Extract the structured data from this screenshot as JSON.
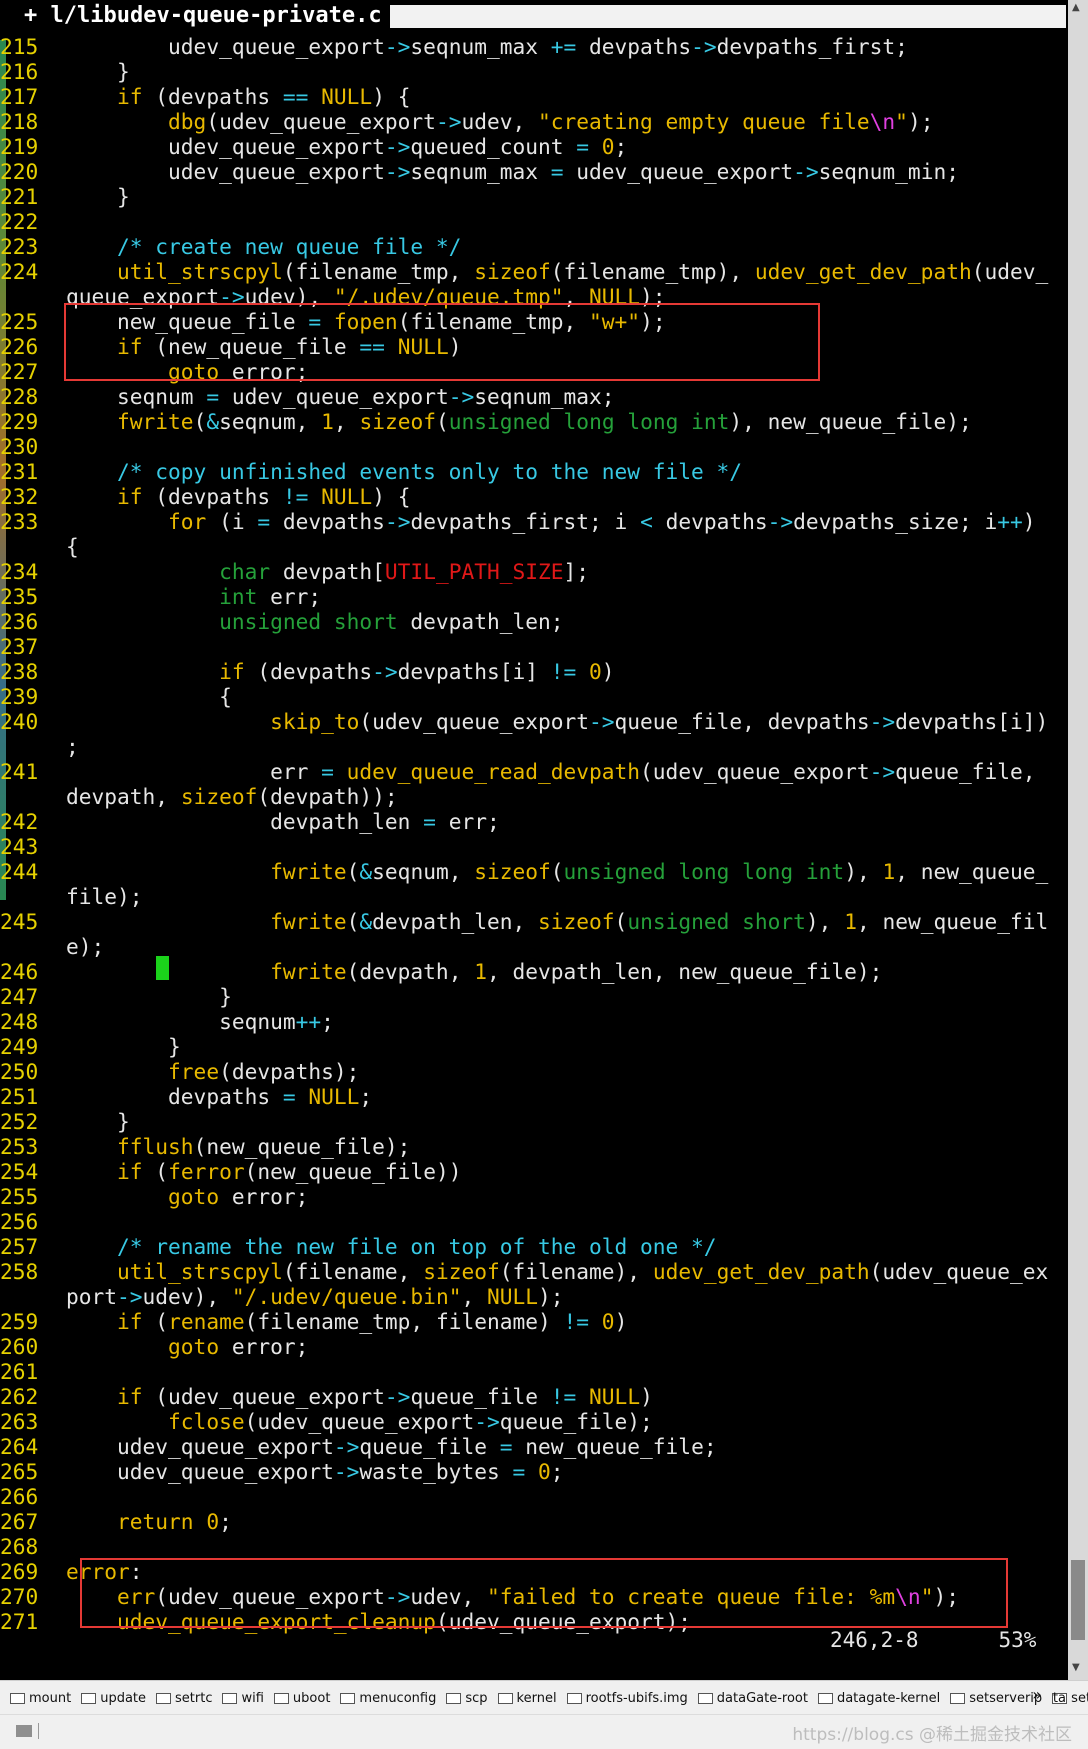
{
  "tab": {
    "label": "+ l/libudev-queue-private.c"
  },
  "ruler": {
    "position": "246,2-8",
    "percent": "53%"
  },
  "bookmarks": [
    "mount",
    "update",
    "setrtc",
    "wifi",
    "uboot",
    "menuconfig",
    "scp",
    "kernel",
    "rootfs-ubifs.img",
    "dataGate-root",
    "datagate-kernel",
    "setserverip",
    "setl"
  ],
  "bookmarks_more": "»",
  "bookmark_trailing": "ta",
  "watermark": "https://blog.cs @稀土掘金技术社区",
  "code_lines": [
    {
      "n": "215",
      "t": [
        [
          "pl",
          "        udev_queue_export"
        ],
        [
          "op",
          "->"
        ],
        [
          "pl",
          "seqnum_max "
        ],
        [
          "op",
          "+="
        ],
        [
          "pl",
          " devpaths"
        ],
        [
          "op",
          "->"
        ],
        [
          "pl",
          "devpaths_first;"
        ]
      ]
    },
    {
      "n": "216",
      "t": [
        [
          "pl",
          "    }"
        ]
      ]
    },
    {
      "n": "217",
      "t": [
        [
          "kw",
          "    if"
        ],
        [
          "pl",
          " (devpaths "
        ],
        [
          "op",
          "=="
        ],
        [
          "pl",
          " "
        ],
        [
          "kw",
          "NULL"
        ],
        [
          "pl",
          ") {"
        ]
      ]
    },
    {
      "n": "218",
      "t": [
        [
          "fn",
          "        dbg"
        ],
        [
          "pl",
          "(udev_queue_export"
        ],
        [
          "op",
          "->"
        ],
        [
          "pl",
          "udev, "
        ],
        [
          "str",
          "\"creating empty queue file"
        ],
        [
          "esc",
          "\\n"
        ],
        [
          "str",
          "\""
        ],
        [
          "pl",
          ");"
        ]
      ]
    },
    {
      "n": "219",
      "t": [
        [
          "pl",
          "        udev_queue_export"
        ],
        [
          "op",
          "->"
        ],
        [
          "pl",
          "queued_count "
        ],
        [
          "op",
          "="
        ],
        [
          "pl",
          " "
        ],
        [
          "kw",
          "0"
        ],
        [
          "pl",
          ";"
        ]
      ]
    },
    {
      "n": "220",
      "t": [
        [
          "pl",
          "        udev_queue_export"
        ],
        [
          "op",
          "->"
        ],
        [
          "pl",
          "seqnum_max "
        ],
        [
          "op",
          "="
        ],
        [
          "pl",
          " udev_queue_export"
        ],
        [
          "op",
          "->"
        ],
        [
          "pl",
          "seqnum_min;"
        ]
      ]
    },
    {
      "n": "221",
      "t": [
        [
          "pl",
          "    }"
        ]
      ]
    },
    {
      "n": "222",
      "t": [
        [
          "pl",
          ""
        ]
      ]
    },
    {
      "n": "223",
      "t": [
        [
          "cm",
          "    /* create new queue file */"
        ]
      ]
    },
    {
      "n": "224",
      "t": [
        [
          "fn",
          "    util_strscpyl"
        ],
        [
          "pl",
          "(filename_tmp, "
        ],
        [
          "kw",
          "sizeof"
        ],
        [
          "pl",
          "(filename_tmp), "
        ],
        [
          "fn",
          "udev_get_dev_path"
        ],
        [
          "pl",
          "(udev_"
        ]
      ]
    },
    {
      "n": "",
      "t": [
        [
          "pl",
          "queue_export"
        ],
        [
          "op",
          "->"
        ],
        [
          "pl",
          "udev), "
        ],
        [
          "str",
          "\"/.udev/queue.tmp\""
        ],
        [
          "pl",
          ", "
        ],
        [
          "kw",
          "NULL"
        ],
        [
          "pl",
          ");"
        ]
      ]
    },
    {
      "n": "225",
      "t": [
        [
          "pl",
          "    new_queue_file "
        ],
        [
          "op",
          "="
        ],
        [
          "pl",
          " "
        ],
        [
          "fn",
          "fopen"
        ],
        [
          "pl",
          "(filename_tmp, "
        ],
        [
          "str",
          "\"w+\""
        ],
        [
          "pl",
          ");"
        ]
      ]
    },
    {
      "n": "226",
      "t": [
        [
          "kw",
          "    if"
        ],
        [
          "pl",
          " (new_queue_file "
        ],
        [
          "op",
          "=="
        ],
        [
          "pl",
          " "
        ],
        [
          "kw",
          "NULL"
        ],
        [
          "pl",
          ")"
        ]
      ]
    },
    {
      "n": "227",
      "t": [
        [
          "kw",
          "        goto"
        ],
        [
          "pl",
          " error;"
        ]
      ]
    },
    {
      "n": "228",
      "t": [
        [
          "pl",
          "    seqnum "
        ],
        [
          "op",
          "="
        ],
        [
          "pl",
          " udev_queue_export"
        ],
        [
          "op",
          "->"
        ],
        [
          "pl",
          "seqnum_max;"
        ]
      ]
    },
    {
      "n": "229",
      "t": [
        [
          "fn",
          "    fwrite"
        ],
        [
          "pl",
          "("
        ],
        [
          "op",
          "&"
        ],
        [
          "pl",
          "seqnum, "
        ],
        [
          "kw",
          "1"
        ],
        [
          "pl",
          ", "
        ],
        [
          "kw",
          "sizeof"
        ],
        [
          "pl",
          "("
        ],
        [
          "ty",
          "unsigned long long int"
        ],
        [
          "pl",
          "), new_queue_file);"
        ]
      ]
    },
    {
      "n": "230",
      "t": [
        [
          "pl",
          ""
        ]
      ]
    },
    {
      "n": "231",
      "t": [
        [
          "cm",
          "    /* copy unfinished events only to the new file */"
        ]
      ]
    },
    {
      "n": "232",
      "t": [
        [
          "kw",
          "    if"
        ],
        [
          "pl",
          " (devpaths "
        ],
        [
          "op",
          "!="
        ],
        [
          "pl",
          " "
        ],
        [
          "kw",
          "NULL"
        ],
        [
          "pl",
          ") {"
        ]
      ]
    },
    {
      "n": "233",
      "t": [
        [
          "kw",
          "        for"
        ],
        [
          "pl",
          " (i "
        ],
        [
          "op",
          "="
        ],
        [
          "pl",
          " devpaths"
        ],
        [
          "op",
          "->"
        ],
        [
          "pl",
          "devpaths_first; i "
        ],
        [
          "op",
          "<"
        ],
        [
          "pl",
          " devpaths"
        ],
        [
          "op",
          "->"
        ],
        [
          "pl",
          "devpaths_size; i"
        ],
        [
          "op",
          "++"
        ],
        [
          "pl",
          ")"
        ]
      ]
    },
    {
      "n": "",
      "t": [
        [
          "pl",
          "{"
        ]
      ]
    },
    {
      "n": "234",
      "t": [
        [
          "ty",
          "            char"
        ],
        [
          "pl",
          " devpath["
        ],
        [
          "mac",
          "UTIL_PATH_SIZE"
        ],
        [
          "pl",
          "];"
        ]
      ]
    },
    {
      "n": "235",
      "t": [
        [
          "ty",
          "            int"
        ],
        [
          "pl",
          " err;"
        ]
      ]
    },
    {
      "n": "236",
      "t": [
        [
          "ty",
          "            unsigned short"
        ],
        [
          "pl",
          " devpath_len;"
        ]
      ]
    },
    {
      "n": "237",
      "t": [
        [
          "pl",
          ""
        ]
      ]
    },
    {
      "n": "238",
      "t": [
        [
          "kw",
          "            if"
        ],
        [
          "pl",
          " (devpaths"
        ],
        [
          "op",
          "->"
        ],
        [
          "pl",
          "devpaths[i] "
        ],
        [
          "op",
          "!="
        ],
        [
          "pl",
          " "
        ],
        [
          "kw",
          "0"
        ],
        [
          "pl",
          ")"
        ]
      ]
    },
    {
      "n": "239",
      "t": [
        [
          "pl",
          "            {"
        ]
      ]
    },
    {
      "n": "240",
      "t": [
        [
          "fn",
          "                skip_to"
        ],
        [
          "pl",
          "(udev_queue_export"
        ],
        [
          "op",
          "->"
        ],
        [
          "pl",
          "queue_file, devpaths"
        ],
        [
          "op",
          "->"
        ],
        [
          "pl",
          "devpaths[i])"
        ]
      ]
    },
    {
      "n": "",
      "t": [
        [
          "pl",
          ";"
        ]
      ]
    },
    {
      "n": "241",
      "t": [
        [
          "pl",
          "                err "
        ],
        [
          "op",
          "="
        ],
        [
          "pl",
          " "
        ],
        [
          "fn",
          "udev_queue_read_devpath"
        ],
        [
          "pl",
          "(udev_queue_export"
        ],
        [
          "op",
          "->"
        ],
        [
          "pl",
          "queue_file,"
        ]
      ]
    },
    {
      "n": "",
      "t": [
        [
          "pl",
          "devpath, "
        ],
        [
          "kw",
          "sizeof"
        ],
        [
          "pl",
          "(devpath));"
        ]
      ]
    },
    {
      "n": "242",
      "t": [
        [
          "pl",
          "                devpath_len "
        ],
        [
          "op",
          "="
        ],
        [
          "pl",
          " err;"
        ]
      ]
    },
    {
      "n": "243",
      "t": [
        [
          "pl",
          ""
        ]
      ]
    },
    {
      "n": "244",
      "t": [
        [
          "fn",
          "                fwrite"
        ],
        [
          "pl",
          "("
        ],
        [
          "op",
          "&"
        ],
        [
          "pl",
          "seqnum, "
        ],
        [
          "kw",
          "sizeof"
        ],
        [
          "pl",
          "("
        ],
        [
          "ty",
          "unsigned long long int"
        ],
        [
          "pl",
          "), "
        ],
        [
          "kw",
          "1"
        ],
        [
          "pl",
          ", new_queue_"
        ]
      ]
    },
    {
      "n": "",
      "t": [
        [
          "pl",
          "file);"
        ]
      ]
    },
    {
      "n": "245",
      "t": [
        [
          "fn",
          "                fwrite"
        ],
        [
          "pl",
          "("
        ],
        [
          "op",
          "&"
        ],
        [
          "pl",
          "devpath_len, "
        ],
        [
          "kw",
          "sizeof"
        ],
        [
          "pl",
          "("
        ],
        [
          "ty",
          "unsigned short"
        ],
        [
          "pl",
          "), "
        ],
        [
          "kw",
          "1"
        ],
        [
          "pl",
          ", new_queue_fil"
        ]
      ]
    },
    {
      "n": "",
      "t": [
        [
          "pl",
          "e);"
        ]
      ]
    },
    {
      "n": "246",
      "t": [
        [
          "fn",
          "                fwrite"
        ],
        [
          "pl",
          "(devpath, "
        ],
        [
          "kw",
          "1"
        ],
        [
          "pl",
          ", devpath_len, new_queue_file);"
        ]
      ]
    },
    {
      "n": "247",
      "t": [
        [
          "pl",
          "            }"
        ]
      ]
    },
    {
      "n": "248",
      "t": [
        [
          "pl",
          "            seqnum"
        ],
        [
          "op",
          "++"
        ],
        [
          "pl",
          ";"
        ]
      ]
    },
    {
      "n": "249",
      "t": [
        [
          "pl",
          "        }"
        ]
      ]
    },
    {
      "n": "250",
      "t": [
        [
          "fn",
          "        free"
        ],
        [
          "pl",
          "(devpaths);"
        ]
      ]
    },
    {
      "n": "251",
      "t": [
        [
          "pl",
          "        devpaths "
        ],
        [
          "op",
          "="
        ],
        [
          "pl",
          " "
        ],
        [
          "kw",
          "NULL"
        ],
        [
          "pl",
          ";"
        ]
      ]
    },
    {
      "n": "252",
      "t": [
        [
          "pl",
          "    }"
        ]
      ]
    },
    {
      "n": "253",
      "t": [
        [
          "fn",
          "    fflush"
        ],
        [
          "pl",
          "(new_queue_file);"
        ]
      ]
    },
    {
      "n": "254",
      "t": [
        [
          "kw",
          "    if"
        ],
        [
          "pl",
          " ("
        ],
        [
          "fn",
          "ferror"
        ],
        [
          "pl",
          "(new_queue_file))"
        ]
      ]
    },
    {
      "n": "255",
      "t": [
        [
          "kw",
          "        goto"
        ],
        [
          "pl",
          " error;"
        ]
      ]
    },
    {
      "n": "256",
      "t": [
        [
          "pl",
          ""
        ]
      ]
    },
    {
      "n": "257",
      "t": [
        [
          "cm",
          "    /* rename the new file on top of the old one */"
        ]
      ]
    },
    {
      "n": "258",
      "t": [
        [
          "fn",
          "    util_strscpyl"
        ],
        [
          "pl",
          "(filename, "
        ],
        [
          "kw",
          "sizeof"
        ],
        [
          "pl",
          "(filename), "
        ],
        [
          "fn",
          "udev_get_dev_path"
        ],
        [
          "pl",
          "(udev_queue_ex"
        ]
      ]
    },
    {
      "n": "",
      "t": [
        [
          "pl",
          "port"
        ],
        [
          "op",
          "->"
        ],
        [
          "pl",
          "udev), "
        ],
        [
          "str",
          "\"/.udev/queue.bin\""
        ],
        [
          "pl",
          ", "
        ],
        [
          "kw",
          "NULL"
        ],
        [
          "pl",
          ");"
        ]
      ]
    },
    {
      "n": "259",
      "t": [
        [
          "kw",
          "    if"
        ],
        [
          "pl",
          " ("
        ],
        [
          "fn",
          "rename"
        ],
        [
          "pl",
          "(filename_tmp, filename) "
        ],
        [
          "op",
          "!="
        ],
        [
          "pl",
          " "
        ],
        [
          "kw",
          "0"
        ],
        [
          "pl",
          ")"
        ]
      ]
    },
    {
      "n": "260",
      "t": [
        [
          "kw",
          "        goto"
        ],
        [
          "pl",
          " error;"
        ]
      ]
    },
    {
      "n": "261",
      "t": [
        [
          "pl",
          ""
        ]
      ]
    },
    {
      "n": "262",
      "t": [
        [
          "kw",
          "    if"
        ],
        [
          "pl",
          " (udev_queue_export"
        ],
        [
          "op",
          "->"
        ],
        [
          "pl",
          "queue_file "
        ],
        [
          "op",
          "!="
        ],
        [
          "pl",
          " "
        ],
        [
          "kw",
          "NULL"
        ],
        [
          "pl",
          ")"
        ]
      ]
    },
    {
      "n": "263",
      "t": [
        [
          "fn",
          "        fclose"
        ],
        [
          "pl",
          "(udev_queue_export"
        ],
        [
          "op",
          "->"
        ],
        [
          "pl",
          "queue_file);"
        ]
      ]
    },
    {
      "n": "264",
      "t": [
        [
          "pl",
          "    udev_queue_export"
        ],
        [
          "op",
          "->"
        ],
        [
          "pl",
          "queue_file "
        ],
        [
          "op",
          "="
        ],
        [
          "pl",
          " new_queue_file;"
        ]
      ]
    },
    {
      "n": "265",
      "t": [
        [
          "pl",
          "    udev_queue_export"
        ],
        [
          "op",
          "->"
        ],
        [
          "pl",
          "waste_bytes "
        ],
        [
          "op",
          "="
        ],
        [
          "pl",
          " "
        ],
        [
          "kw",
          "0"
        ],
        [
          "pl",
          ";"
        ]
      ]
    },
    {
      "n": "266",
      "t": [
        [
          "pl",
          ""
        ]
      ]
    },
    {
      "n": "267",
      "t": [
        [
          "kw",
          "    return"
        ],
        [
          "pl",
          " "
        ],
        [
          "kw",
          "0"
        ],
        [
          "pl",
          ";"
        ]
      ]
    },
    {
      "n": "268",
      "t": [
        [
          "pl",
          ""
        ]
      ]
    },
    {
      "n": "269",
      "t": [
        [
          "kw",
          "error"
        ],
        [
          "pl",
          ":"
        ]
      ]
    },
    {
      "n": "270",
      "t": [
        [
          "fn",
          "    err"
        ],
        [
          "pl",
          "(udev_queue_export"
        ],
        [
          "op",
          "->"
        ],
        [
          "pl",
          "udev, "
        ],
        [
          "str",
          "\"failed to create queue file: %m"
        ],
        [
          "esc",
          "\\n"
        ],
        [
          "str",
          "\""
        ],
        [
          "pl",
          ");"
        ]
      ]
    },
    {
      "n": "271",
      "t": [
        [
          "fn",
          "    udev_queue_export_cleanup"
        ],
        [
          "pl",
          "(udev_queue_export);"
        ]
      ]
    }
  ]
}
